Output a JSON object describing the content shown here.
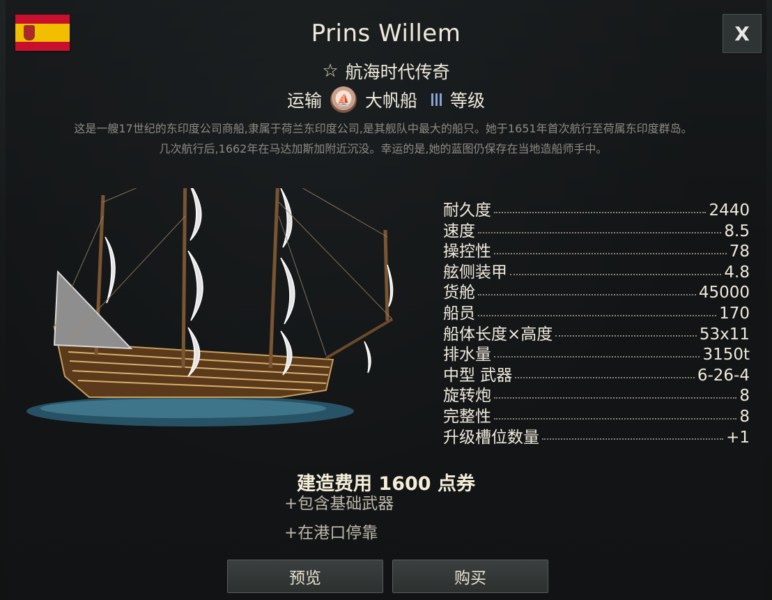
{
  "header": {
    "title": "Prins  Willem",
    "subtitle": "航海时代传奇",
    "close_label": "X",
    "type": "运输",
    "ship_class": "大帆船",
    "rank_label": "等级"
  },
  "description": "这是一艘17世纪的东印度公司商船,隶属于荷兰东印度公司,是其舰队中最大的船只。她于1651年首次航行至荷属东印度群岛。几次航行后,1662年在马达加斯加附近沉没。幸运的是,她的蓝图仍保存在当地造船师手中。",
  "stats": [
    {
      "label": "耐久度",
      "value": "2440"
    },
    {
      "label": "速度",
      "value": "8.5"
    },
    {
      "label": "操控性",
      "value": "78"
    },
    {
      "label": "舷侧装甲",
      "value": "4.8"
    },
    {
      "label": "货舱",
      "value": "45000"
    },
    {
      "label": "船员",
      "value": "170"
    },
    {
      "label": "船体长度×高度",
      "value": "53x11"
    },
    {
      "label": "排水量",
      "value": "3150t"
    },
    {
      "label": "中型  武器",
      "value": "6-26-4"
    },
    {
      "label": "旋转炮",
      "value": "8"
    },
    {
      "label": "完整性",
      "value": "8"
    },
    {
      "label": "升级槽位数量",
      "value": "+1"
    }
  ],
  "purchase": {
    "cost": "建造费用 1600  点券",
    "includes": [
      "+包含基础武器",
      "+在港口停靠"
    ],
    "preview_label": "预览",
    "buy_label": "购买"
  },
  "icons": {
    "flag": "spain-flag-icon",
    "favorite": "star-outline-icon",
    "class_badge": "galleon-class-icon",
    "tier": "tier-bars-icon"
  },
  "colors": {
    "accent_tier": "#8aa4d6",
    "text_primary": "#f0eadc",
    "text_muted": "#8c8a84"
  }
}
